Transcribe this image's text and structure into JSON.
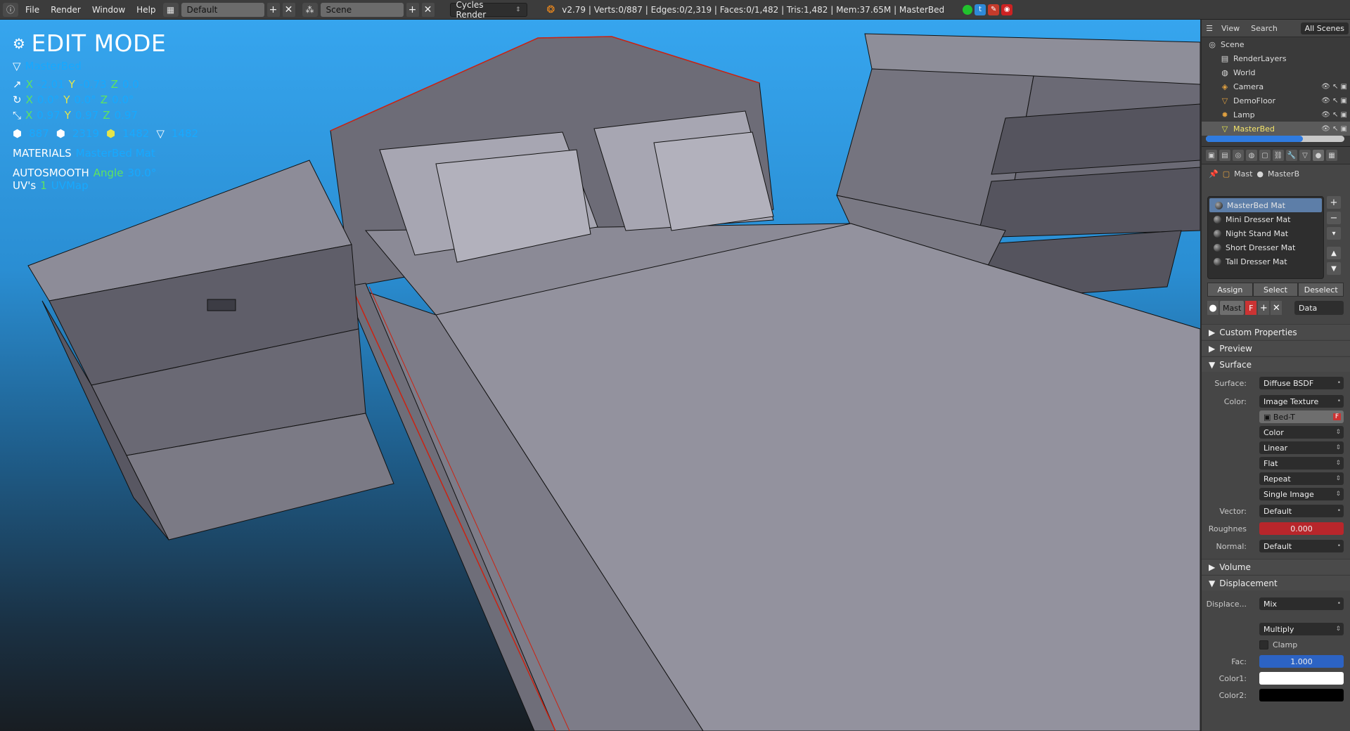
{
  "topbar": {
    "menu": [
      "File",
      "Render",
      "Window",
      "Help"
    ],
    "layout": "Default",
    "scene": "Scene",
    "engine": "Cycles Render",
    "stats": "v2.79 | Verts:0/887 | Edges:0/2,319 | Faces:0/1,482 | Tris:1,482 | Mem:37.65M | MasterBed"
  },
  "overlay": {
    "mode": "EDIT MODE",
    "object": "MasterBed",
    "loc": {
      "x": "-2.01",
      "y": "-0.73",
      "z": "0.0"
    },
    "rot": {
      "x": "0.0°",
      "y": "0.0°",
      "z": "0.0°"
    },
    "scale": {
      "x": "0.97",
      "y": "0.97",
      "z": "0.97"
    },
    "counts": {
      "verts": "887",
      "edges": "2319",
      "faces": "1482",
      "tris": "1482"
    },
    "materials_label": "MATERIALS",
    "materials_value": "MasterBed Mat",
    "autosmooth_label": "AUTOSMOOTH",
    "angle_label": "Angle",
    "angle_value": "30.0°",
    "uvs_label": "UV's",
    "uvs_count": "1",
    "uvs_name": "UVMap"
  },
  "outliner": {
    "header": {
      "view": "View",
      "search": "Search",
      "filter": "All Scenes"
    },
    "items": [
      {
        "name": "Scene",
        "icon": "scene-icon"
      },
      {
        "name": "RenderLayers",
        "icon": "renderlayers-icon"
      },
      {
        "name": "World",
        "icon": "world-icon"
      },
      {
        "name": "Camera",
        "icon": "camera-icon"
      },
      {
        "name": "DemoFloor",
        "icon": "mesh-icon"
      },
      {
        "name": "Lamp",
        "icon": "lamp-icon"
      },
      {
        "name": "MasterBed",
        "icon": "mesh-icon"
      }
    ]
  },
  "props": {
    "crumb": {
      "object": "Mast",
      "material": "MasterB"
    },
    "materials": [
      "MasterBed Mat",
      "Mini Dresser Mat",
      "Night Stand Mat",
      "Short Dresser Mat",
      "Tall Dresser Mat"
    ],
    "assign": "Assign",
    "select": "Select",
    "deselect": "Deselect",
    "slot_name": "Mast",
    "slot_flag": "F",
    "slot_link": "Data",
    "sections": {
      "custom": "Custom Properties",
      "preview": "Preview",
      "surface": "Surface",
      "volume": "Volume",
      "displacement": "Displacement"
    },
    "surface": {
      "surface_label": "Surface:",
      "surface_value": "Diffuse BSDF",
      "color_label": "Color:",
      "color_value": "Image Texture",
      "image_name": "Bed-T",
      "color_space": "Color",
      "interpolation": "Linear",
      "projection": "Flat",
      "extension": "Repeat",
      "source": "Single Image",
      "vector_label": "Vector:",
      "vector_value": "Default",
      "rough_label": "Roughnes",
      "rough_value": "0.000",
      "normal_label": "Normal:",
      "normal_value": "Default"
    },
    "displacement": {
      "disp_label": "Displace...",
      "disp_value": "Mix",
      "blend": "Multiply",
      "clamp": "Clamp",
      "fac_label": "Fac:",
      "fac_value": "1.000",
      "color1_label": "Color1:",
      "color2_label": "Color2:"
    }
  }
}
